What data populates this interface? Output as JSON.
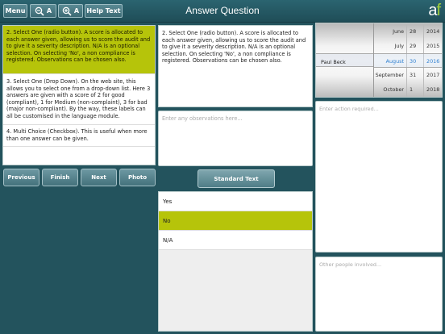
{
  "toolbar": {
    "menu_label": "Menu",
    "zoom_out_label": "A",
    "zoom_in_label": "A",
    "help_label": "Help Text",
    "title": "Answer Question",
    "logo_a": "a",
    "logo_f": "f",
    "zoom_out_icon": "zoom-out-icon",
    "zoom_in_icon": "zoom-in-icon"
  },
  "questions": [
    {
      "text": "2. Select One (radio button).  A score is allocated to each answer given, allowing us to score the audit and to give it a severity description.  N/A is an optional selection.  On selecting 'No', a non compliance is registered.  Observations can be chosen also.",
      "active": true
    },
    {
      "text": "3. Select One (Drop Down).  On the web site, this allows you to select one from a drop-down list.  Here 3 answers are given with a score of 2 for good (compliant), 1 for Medium (non-complaint), 3 for bad (major non-compliant).  By the way, these labels can all be customised in the language module.",
      "active": false
    },
    {
      "text": "4. Multi Choice (Checkbox).  This is useful when more than one answer can be given.",
      "active": false
    }
  ],
  "nav": {
    "previous": "Previous",
    "finish": "Finish",
    "next": "Next",
    "photo": "Photo"
  },
  "question_detail": "2. Select One (radio button).  A score is allocated to each answer given, allowing us to score the audit and to give it a severity description.  N/A is an optional selection.  On selecting 'No', a non compliance is registered.  Observations can be chosen also.",
  "observations": {
    "placeholder": "Enter any observations here..."
  },
  "standard_text_label": "Standard Text",
  "answers": [
    {
      "label": "Yes",
      "selected": false
    },
    {
      "label": "No",
      "selected": true
    },
    {
      "label": "N/A",
      "selected": false
    }
  ],
  "picker": {
    "person": "Paul Beck",
    "dates": [
      {
        "month": "June",
        "day": "28",
        "year": "2014"
      },
      {
        "month": "July",
        "day": "29",
        "year": "2015"
      },
      {
        "month": "August",
        "day": "30",
        "year": "2016",
        "current": true
      },
      {
        "month": "September",
        "day": "31",
        "year": "2017"
      },
      {
        "month": "October",
        "day": "1",
        "year": "2018"
      }
    ],
    "highlight_color": "#2e7fd0"
  },
  "action": {
    "placeholder": "Enter action required..."
  },
  "people": {
    "placeholder": "Other people involved..."
  },
  "colors": {
    "background": "#23535d",
    "selected": "#b6c40a",
    "logo_f": "#9fcf3a"
  }
}
